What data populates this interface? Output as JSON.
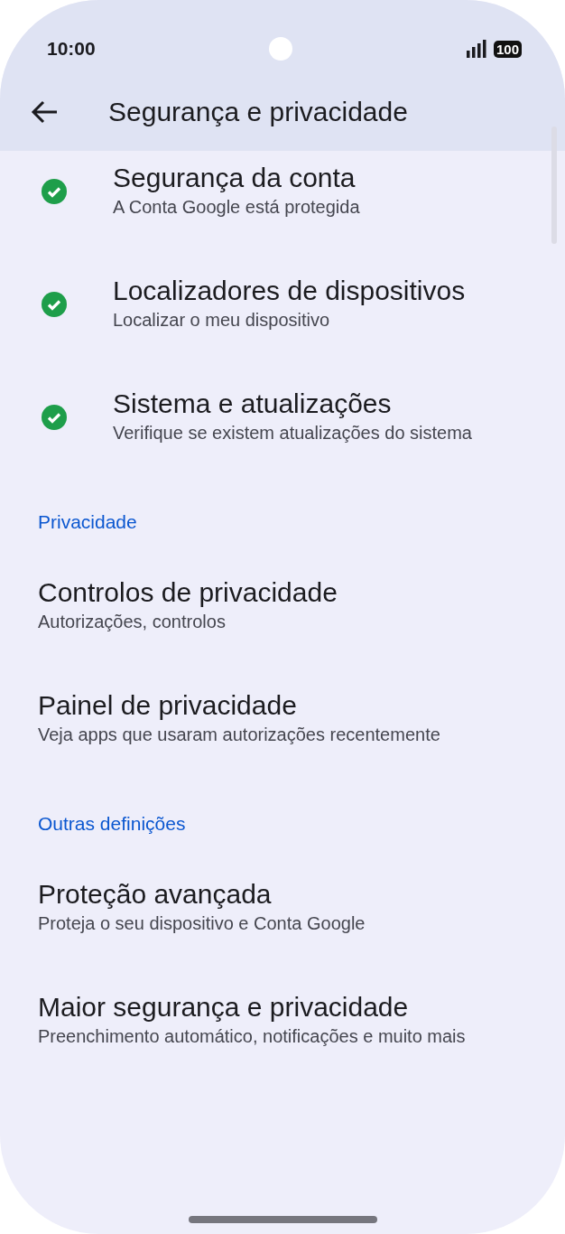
{
  "status_bar": {
    "time": "10:00",
    "battery": "100"
  },
  "app_bar": {
    "title": "Segurança e privacidade"
  },
  "sections": [
    {
      "items": [
        {
          "kind": "status",
          "title": "Segurança da conta",
          "subtitle": "A Conta Google está protegida"
        },
        {
          "kind": "status",
          "title": "Localizadores de dispositivos",
          "subtitle": "Localizar o meu dispositivo"
        },
        {
          "kind": "status",
          "title": "Sistema e atualizações",
          "subtitle": "Verifique se existem atualizações do sistema"
        }
      ]
    },
    {
      "header": "Privacidade",
      "items": [
        {
          "kind": "plain",
          "title": "Controlos de privacidade",
          "subtitle": "Autorizações, controlos"
        },
        {
          "kind": "plain",
          "title": "Painel de privacidade",
          "subtitle": "Veja apps que usaram autorizações recentemente"
        }
      ]
    },
    {
      "header": "Outras definições",
      "items": [
        {
          "kind": "plain",
          "title": "Proteção avançada",
          "subtitle": "Proteja o seu dispositivo e Conta Google"
        },
        {
          "kind": "plain",
          "title": "Maior segurança e privacidade",
          "subtitle": "Preenchimento automático, notificações e muito mais"
        }
      ]
    }
  ]
}
